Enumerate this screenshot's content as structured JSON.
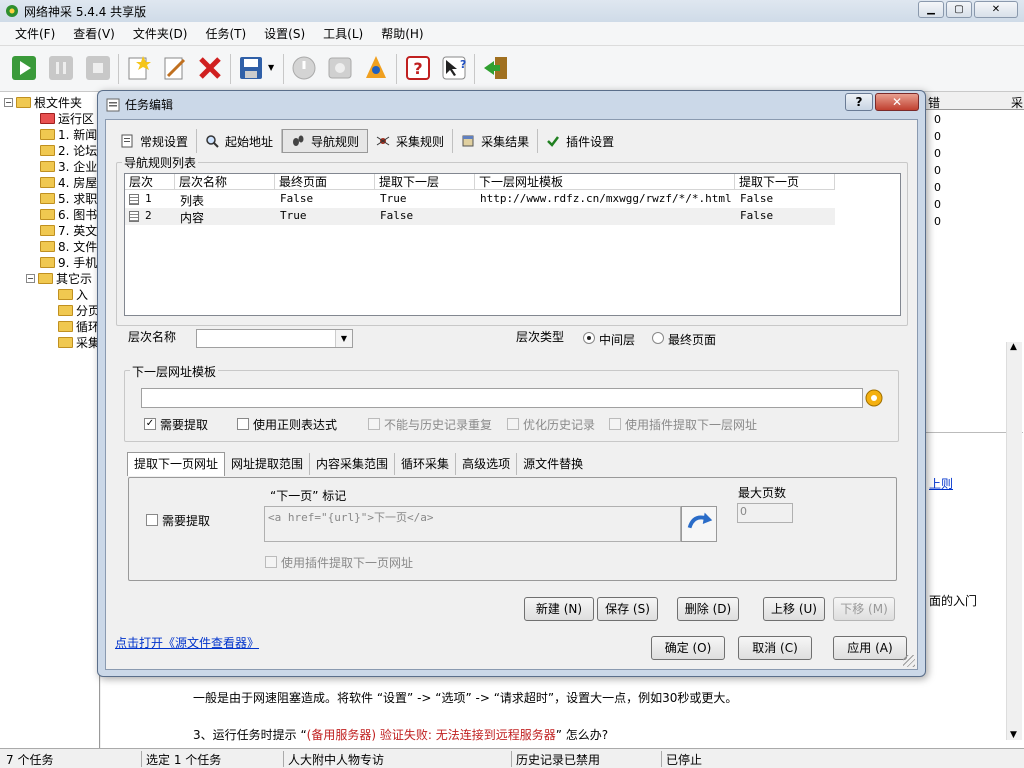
{
  "app": {
    "title": "网络神采 5.4.4 共享版"
  },
  "menu": [
    "文件(F)",
    "查看(V)",
    "文件夹(D)",
    "任务(T)",
    "设置(S)",
    "工具(L)",
    "帮助(H)"
  ],
  "tree": {
    "root": "根文件夹",
    "items": [
      "运行区",
      "1. 新闻",
      "2. 论坛",
      "3. 企业",
      "4. 房屋",
      "5. 求职",
      "6. 图书",
      "7. 英文",
      "8. 文件",
      "9. 手机"
    ],
    "other": "其它示",
    "other_items": [
      "入",
      "分页",
      "循环",
      "采集"
    ]
  },
  "grid": {
    "col_err": "错",
    "col_sample": "采",
    "zeros": [
      "0",
      "0",
      "0",
      "0",
      "0",
      "0",
      "0"
    ]
  },
  "background_text": {
    "link1": "上则",
    "line_entry": "面的入门",
    "para1": "一般是由于网速阻塞造成。将软件 “设置” -> “选项” -> “请求超时”，设置大一点，例如30秒或更大。",
    "para2_prefix": "3、运行任务时提示 “",
    "para2_red": "(备用服务器) 验证失败: 无法连接到远程服务器",
    "para2_suffix": "” 怎么办?"
  },
  "status": {
    "count": "7 个任务",
    "selected": "选定 1 个任务",
    "task": "人大附中人物专访",
    "history": "历史记录已禁用",
    "state": "已停止"
  },
  "dialog": {
    "title": "任务编辑",
    "help": "?",
    "tabs": [
      "常规设置",
      "起始地址",
      "导航规则",
      "采集规则",
      "采集结果",
      "插件设置"
    ],
    "nav_list_label": "导航规则列表",
    "columns": [
      "层次",
      "层次名称",
      "最终页面",
      "提取下一层",
      "下一层网址模板",
      "提取下一页"
    ],
    "rows": [
      {
        "level": "1",
        "name": "列表",
        "final": "False",
        "extract_next_level": "True",
        "template": "http://www.rdfz.cn/mxwgg/rwzf/*/*.html",
        "extract_next_page": "False"
      },
      {
        "level": "2",
        "name": "内容",
        "final": "True",
        "extract_next_level": "False",
        "template": "",
        "extract_next_page": "False"
      }
    ],
    "level_name_label": "层次名称",
    "level_name_value": "",
    "level_type_label": "层次类型",
    "type_middle": "中间层",
    "type_final": "最终页面",
    "next_url_group": "下一层网址模板",
    "next_url_value": "",
    "need_extract": "需要提取",
    "use_regex": "使用正则表达式",
    "no_dup_history": "不能与历史记录重复",
    "optimize_history": "优化历史记录",
    "use_plugin_next_level": "使用插件提取下一层网址",
    "inner_tabs": [
      "提取下一页网址",
      "网址提取范围",
      "内容采集范围",
      "循环采集",
      "高级选项",
      "源文件替换"
    ],
    "next_page_need_extract": "需要提取",
    "next_page_marker_label": "“下一页” 标记",
    "next_page_marker_value": "<a href=\"{url}\">下一页</a>",
    "max_pages_label": "最大页数",
    "max_pages_value": "0",
    "use_plugin_next_page": "使用插件提取下一页网址",
    "btn_new": "新建 (N)",
    "btn_save": "保存 (S)",
    "btn_delete": "删除 (D)",
    "btn_up": "上移 (U)",
    "btn_down": "下移 (M)",
    "link_source_viewer": "点击打开《源文件查看器》",
    "btn_ok": "确定 (O)",
    "btn_cancel": "取消 (C)",
    "btn_apply": "应用 (A)"
  }
}
